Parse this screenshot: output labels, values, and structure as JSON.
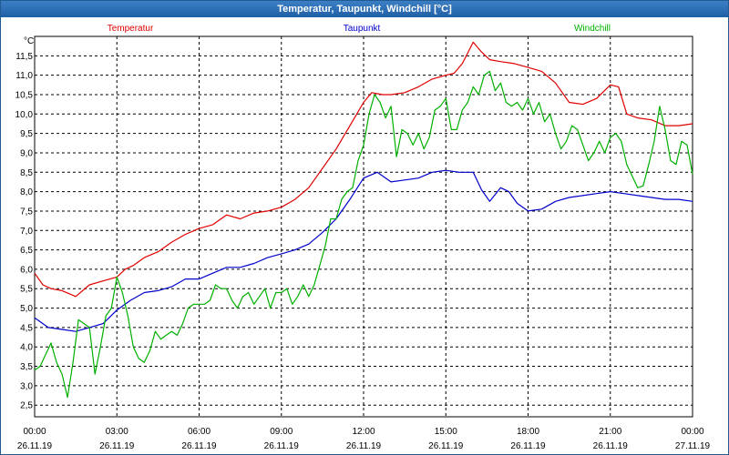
{
  "window": {
    "title": "Temperatur, Taupunkt, Windchill [°C]"
  },
  "chart_data": {
    "type": "line",
    "title": "Temperatur, Taupunkt, Windchill [°C]",
    "ylabel": "°C",
    "ylim": [
      2.2,
      12.0
    ],
    "yticks": [
      2.5,
      3.0,
      3.5,
      4.0,
      4.5,
      5.0,
      5.5,
      6.0,
      6.5,
      7.0,
      7.5,
      8.0,
      8.5,
      9.0,
      9.5,
      10.0,
      10.5,
      11.0,
      11.5
    ],
    "ytick_labels": [
      "2,5",
      "3,0",
      "3,5",
      "4,0",
      "4,5",
      "5,0",
      "5,5",
      "6,0",
      "6,5",
      "7,0",
      "7,5",
      "8,0",
      "8,5",
      "9,0",
      "9,5",
      "10,0",
      "10,5",
      "11,0",
      "11,5"
    ],
    "xlim": [
      0,
      24
    ],
    "xticks": [
      {
        "x": 0,
        "time": "00:00",
        "date": "26.11.19"
      },
      {
        "x": 3,
        "time": "03:00",
        "date": "26.11.19"
      },
      {
        "x": 6,
        "time": "06:00",
        "date": "26.11.19"
      },
      {
        "x": 9,
        "time": "09:00",
        "date": "26.11.19"
      },
      {
        "x": 12,
        "time": "12:00",
        "date": "26.11.19"
      },
      {
        "x": 15,
        "time": "15:00",
        "date": "26.11.19"
      },
      {
        "x": 18,
        "time": "18:00",
        "date": "26.11.19"
      },
      {
        "x": 21,
        "time": "21:00",
        "date": "26.11.19"
      },
      {
        "x": 24,
        "time": "00:00",
        "date": "27.11.19"
      }
    ],
    "grid": true,
    "legend": "top",
    "series": [
      {
        "name": "Temperatur",
        "color": "#e00000",
        "x": [
          0,
          0.3,
          0.6,
          1.0,
          1.5,
          2.0,
          2.5,
          3.0,
          3.3,
          3.6,
          4.0,
          4.5,
          5.0,
          5.5,
          6.0,
          6.5,
          7.0,
          7.5,
          8.0,
          8.5,
          9.0,
          9.5,
          10.0,
          10.5,
          11.0,
          11.5,
          12.0,
          12.3,
          12.7,
          13.0,
          13.5,
          14.0,
          14.5,
          15.0,
          15.3,
          15.6,
          16.0,
          16.3,
          16.6,
          17.0,
          17.5,
          18.0,
          18.5,
          19.0,
          19.5,
          20.0,
          20.5,
          21.0,
          21.3,
          21.6,
          22.0,
          22.5,
          23.0,
          23.5,
          24.0
        ],
        "y": [
          5.9,
          5.6,
          5.5,
          5.45,
          5.3,
          5.6,
          5.7,
          5.8,
          6.0,
          6.1,
          6.3,
          6.45,
          6.7,
          6.9,
          7.05,
          7.15,
          7.4,
          7.3,
          7.45,
          7.5,
          7.6,
          7.8,
          8.1,
          8.6,
          9.1,
          9.7,
          10.3,
          10.55,
          10.5,
          10.5,
          10.55,
          10.7,
          10.9,
          11.0,
          11.05,
          11.3,
          11.85,
          11.6,
          11.4,
          11.35,
          11.3,
          11.2,
          11.1,
          10.8,
          10.3,
          10.25,
          10.4,
          10.75,
          10.7,
          10.0,
          9.9,
          9.85,
          9.7,
          9.7,
          9.75
        ]
      },
      {
        "name": "Taupunkt",
        "color": "#0000cc",
        "x": [
          0,
          0.5,
          1.0,
          1.5,
          2.0,
          2.5,
          3.0,
          3.5,
          4.0,
          4.5,
          5.0,
          5.5,
          6.0,
          6.5,
          7.0,
          7.5,
          8.0,
          8.5,
          9.0,
          9.5,
          10.0,
          10.5,
          11.0,
          11.5,
          12.0,
          12.5,
          13.0,
          13.5,
          14.0,
          14.5,
          15.0,
          15.5,
          16.0,
          16.3,
          16.6,
          17.0,
          17.3,
          17.6,
          18.0,
          18.5,
          19.0,
          19.5,
          20.0,
          20.5,
          21.0,
          21.5,
          22.0,
          22.5,
          23.0,
          23.5,
          24.0
        ],
        "y": [
          4.75,
          4.5,
          4.45,
          4.4,
          4.5,
          4.6,
          4.95,
          5.2,
          5.4,
          5.45,
          5.55,
          5.75,
          5.75,
          5.9,
          6.05,
          6.05,
          6.15,
          6.3,
          6.4,
          6.5,
          6.65,
          6.95,
          7.3,
          7.8,
          8.35,
          8.5,
          8.25,
          8.3,
          8.35,
          8.5,
          8.55,
          8.5,
          8.5,
          8.05,
          7.75,
          8.1,
          8.0,
          7.7,
          7.5,
          7.55,
          7.75,
          7.85,
          7.9,
          7.95,
          8.0,
          7.95,
          7.9,
          7.85,
          7.8,
          7.8,
          7.75
        ]
      },
      {
        "name": "Windchill",
        "color": "#00b000",
        "x": [
          0,
          0.2,
          0.4,
          0.6,
          0.8,
          1.0,
          1.2,
          1.4,
          1.6,
          1.8,
          2.0,
          2.2,
          2.4,
          2.6,
          2.8,
          3.0,
          3.2,
          3.4,
          3.6,
          3.8,
          4.0,
          4.2,
          4.4,
          4.6,
          4.8,
          5.0,
          5.2,
          5.4,
          5.6,
          5.8,
          6.0,
          6.2,
          6.4,
          6.6,
          6.8,
          7.0,
          7.2,
          7.4,
          7.6,
          7.8,
          8.0,
          8.2,
          8.4,
          8.6,
          8.8,
          9.0,
          9.2,
          9.4,
          9.6,
          9.8,
          10.0,
          10.2,
          10.4,
          10.6,
          10.8,
          11.0,
          11.2,
          11.4,
          11.6,
          11.8,
          12.0,
          12.2,
          12.4,
          12.6,
          12.8,
          13.0,
          13.2,
          13.4,
          13.6,
          13.8,
          14.0,
          14.2,
          14.4,
          14.6,
          14.8,
          15.0,
          15.2,
          15.4,
          15.6,
          15.8,
          16.0,
          16.2,
          16.4,
          16.6,
          16.8,
          17.0,
          17.2,
          17.4,
          17.6,
          17.8,
          18.0,
          18.2,
          18.4,
          18.6,
          18.8,
          19.0,
          19.2,
          19.4,
          19.6,
          19.8,
          20.0,
          20.2,
          20.4,
          20.6,
          20.8,
          21.0,
          21.2,
          21.4,
          21.6,
          21.8,
          22.0,
          22.2,
          22.4,
          22.6,
          22.8,
          23.0,
          23.2,
          23.4,
          23.6,
          23.8,
          24.0
        ],
        "y": [
          3.4,
          3.5,
          3.8,
          4.1,
          3.6,
          3.3,
          2.7,
          3.6,
          4.7,
          4.6,
          4.5,
          3.3,
          4.0,
          4.8,
          5.0,
          5.8,
          5.4,
          4.8,
          4.0,
          3.7,
          3.6,
          3.9,
          4.4,
          4.2,
          4.3,
          4.4,
          4.3,
          4.6,
          5.0,
          5.1,
          5.1,
          5.1,
          5.2,
          5.6,
          5.5,
          5.5,
          5.2,
          5.0,
          5.3,
          5.4,
          5.1,
          5.3,
          5.5,
          5.0,
          5.4,
          5.4,
          5.5,
          5.1,
          5.3,
          5.6,
          5.3,
          5.6,
          6.1,
          6.6,
          7.3,
          7.3,
          7.8,
          8.0,
          8.1,
          8.8,
          9.2,
          10.0,
          10.5,
          10.3,
          9.9,
          10.2,
          8.9,
          9.6,
          9.5,
          9.2,
          9.5,
          9.1,
          9.4,
          10.1,
          10.2,
          10.4,
          9.6,
          9.6,
          10.1,
          10.3,
          10.7,
          10.5,
          11.0,
          11.1,
          10.6,
          10.8,
          10.3,
          10.2,
          10.3,
          10.1,
          10.4,
          10.0,
          10.3,
          9.8,
          10.0,
          9.5,
          9.1,
          9.3,
          9.7,
          9.6,
          9.2,
          8.8,
          9.0,
          9.3,
          9.0,
          9.4,
          9.5,
          9.3,
          8.7,
          8.4,
          8.1,
          8.15,
          8.7,
          9.3,
          10.2,
          9.6,
          8.8,
          8.7,
          9.3,
          9.2,
          8.45
        ]
      }
    ]
  }
}
